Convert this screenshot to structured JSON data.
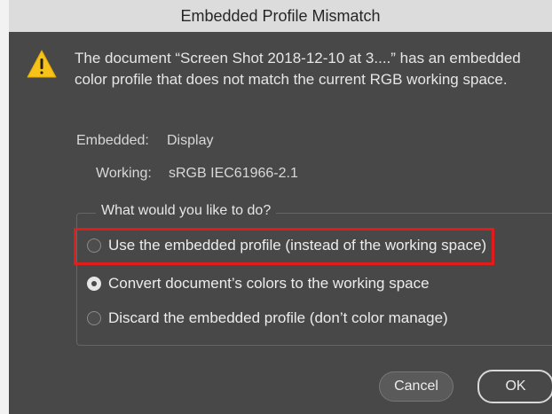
{
  "window": {
    "title": "Embedded Profile Mismatch"
  },
  "message": "The document “Screen Shot 2018-12-10 at 3....” has an embedded color profile that does not match the current RGB working space.",
  "embedded": {
    "label": "Embedded:",
    "value": "Display"
  },
  "working": {
    "label": "Working:",
    "value": "sRGB IEC61966-2.1"
  },
  "question": "What would you like to do?",
  "options": [
    {
      "label": "Use the embedded profile (instead of the working space)",
      "selected": false
    },
    {
      "label": "Convert document’s colors to the working space",
      "selected": true
    },
    {
      "label": "Discard the embedded profile (don’t color manage)",
      "selected": false
    }
  ],
  "buttons": {
    "cancel": "Cancel",
    "ok": "OK"
  },
  "icons": {
    "warning": "warning-icon"
  },
  "colors": {
    "warning": "#f7c31a",
    "highlight": "#e21b1b",
    "panel": "#484848"
  }
}
